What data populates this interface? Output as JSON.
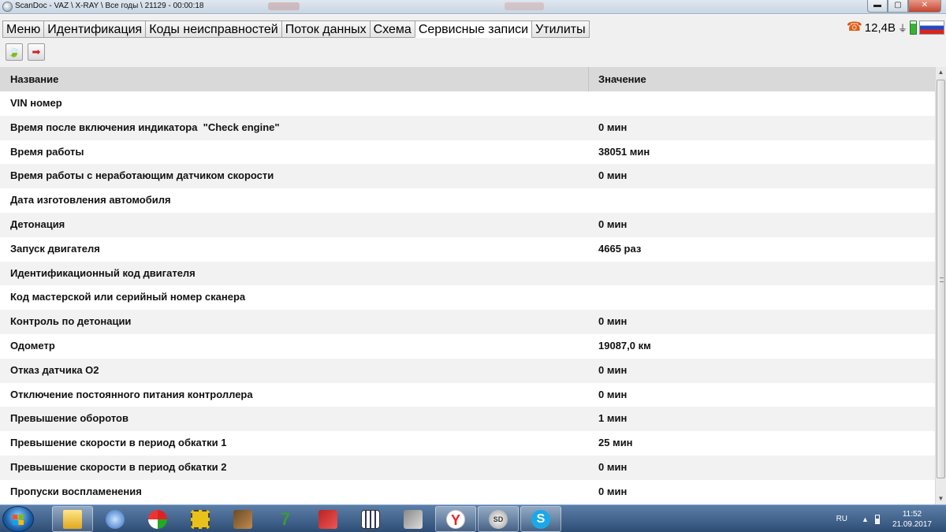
{
  "window": {
    "title": "ScanDoc - VAZ \\ X-RAY \\ Все годы \\ 21129 - 00:00:18",
    "controls": {
      "minimize": "▬",
      "maximize": "▢",
      "close": "✕"
    }
  },
  "tabs": [
    {
      "label": "Меню",
      "active": false
    },
    {
      "label": "Идентификация",
      "active": false
    },
    {
      "label": "Коды неисправностей",
      "active": false
    },
    {
      "label": "Поток данных",
      "active": false
    },
    {
      "label": "Схема",
      "active": false
    },
    {
      "label": "Сервисные записи",
      "active": true
    },
    {
      "label": "Утилиты",
      "active": false
    }
  ],
  "status": {
    "voltage": "12,4В",
    "icons": [
      "phone-icon",
      "plug-icon",
      "battery-icon",
      "russia-flag-icon"
    ],
    "phone_glyph": "☎",
    "plug_glyph": "⏚"
  },
  "toolbar": {
    "buttons": [
      {
        "icon": "leaf-icon",
        "glyph": "🍃"
      },
      {
        "icon": "exit-arrow-icon",
        "glyph": "➡"
      }
    ]
  },
  "table": {
    "columns": [
      "Название",
      "Значение"
    ],
    "rows": [
      [
        "VIN номер",
        ""
      ],
      [
        "Время после включения индикатора  \"Check engine\"",
        "0 мин"
      ],
      [
        "Время работы",
        "38051 мин"
      ],
      [
        "Время работы с неработающим датчиком скорости",
        "0 мин"
      ],
      [
        "Дата изготовления автомобиля",
        ""
      ],
      [
        "Детонация",
        "0 мин"
      ],
      [
        "Запуск двигателя",
        "4665 раз"
      ],
      [
        "Идентификационный код двигателя",
        ""
      ],
      [
        "Код мастерской или серийный номер сканера",
        ""
      ],
      [
        "Контроль по детонации",
        "0 мин"
      ],
      [
        "Одометр",
        "19087,0 км"
      ],
      [
        "Отказ датчика O2",
        "0 мин"
      ],
      [
        "Отключение постоянного питания контроллера",
        "0 мин"
      ],
      [
        "Превышение оборотов",
        "1 мин"
      ],
      [
        "Превышение скорости в период обкатки 1",
        "25 мин"
      ],
      [
        "Превышение скорости в период обкатки 2",
        "0 мин"
      ],
      [
        "Пропуски воспламенения",
        "0 мин"
      ]
    ]
  },
  "scrollbar": {
    "up": "▲",
    "down": "▼"
  },
  "taskbar": {
    "apps": [
      {
        "icon": "file-explorer-icon",
        "glyph": "",
        "cls": "g-folder",
        "pinned": true
      },
      {
        "icon": "scandoc-app-icon",
        "glyph": "",
        "cls": "g-blue",
        "pinned": false
      },
      {
        "icon": "diagnostic-app-icon",
        "glyph": "",
        "cls": "g-green",
        "pinned": false
      },
      {
        "icon": "chip-icon",
        "glyph": "",
        "cls": "g-chip",
        "pinned": false
      },
      {
        "icon": "ecu-chip-icon",
        "glyph": "",
        "cls": "g-chip2",
        "pinned": false
      },
      {
        "icon": "7zip-icon",
        "glyph": "7",
        "cls": "g-seven",
        "pinned": false
      },
      {
        "icon": "car-diagnostic-icon",
        "glyph": "",
        "cls": "g-red",
        "pinned": false
      },
      {
        "icon": "terminal-icon",
        "glyph": "",
        "cls": "g-grid",
        "pinned": false
      },
      {
        "icon": "ecu-flasher-icon",
        "glyph": "",
        "cls": "g-ecu",
        "pinned": false
      },
      {
        "icon": "yandex-browser-icon",
        "glyph": "Y",
        "cls": "g-yandex",
        "pinned": true
      },
      {
        "icon": "scandoc-sd-icon",
        "glyph": "SD",
        "cls": "g-sd",
        "pinned": true
      },
      {
        "icon": "skype-icon",
        "glyph": "S",
        "cls": "g-skype",
        "pinned": true
      }
    ],
    "language": "RU",
    "tray_up": "▲",
    "time": "11:52",
    "date": "21.09.2017"
  }
}
